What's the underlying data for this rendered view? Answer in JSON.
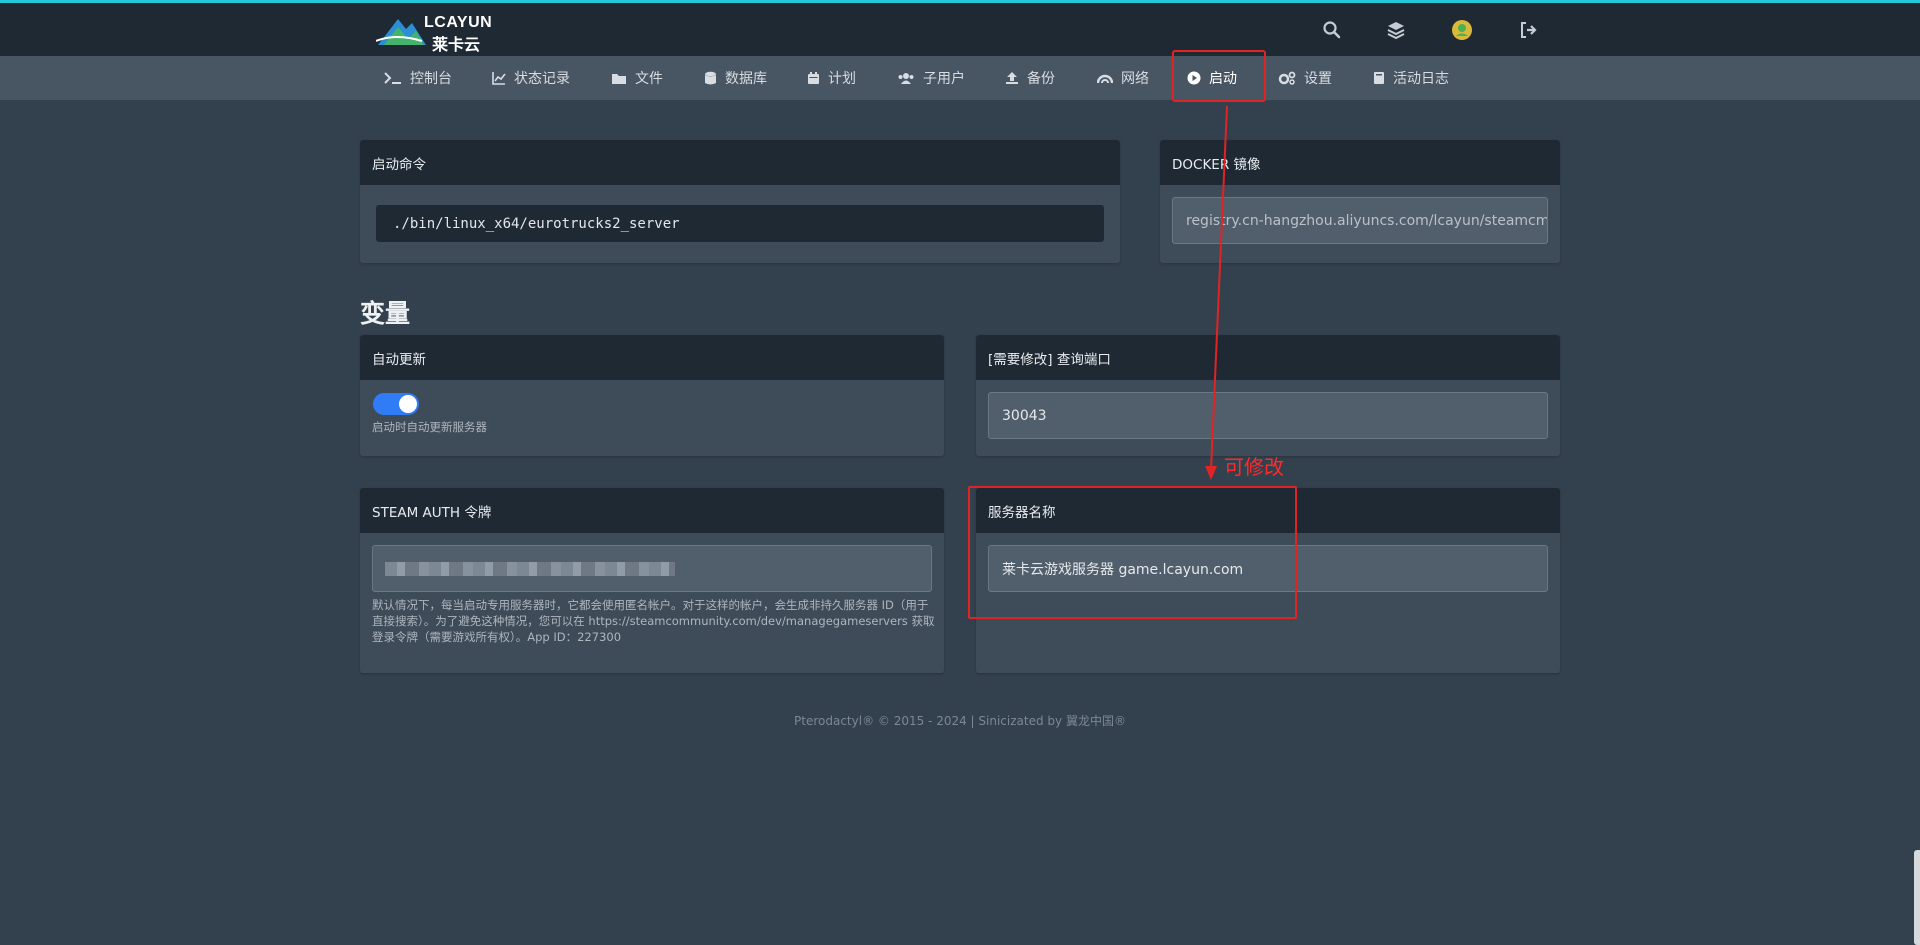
{
  "brand": {
    "logo_text_en": "LCAYUN",
    "logo_text_cn": "莱卡云"
  },
  "topbar": {
    "icons": [
      "search-icon",
      "layers-icon",
      "user-avatar-icon",
      "logout-icon"
    ]
  },
  "nav": {
    "items": [
      {
        "label": "控制台",
        "icon": "terminal-icon"
      },
      {
        "label": "状态记录",
        "icon": "chart-icon"
      },
      {
        "label": "文件",
        "icon": "folder-icon"
      },
      {
        "label": "数据库",
        "icon": "database-icon"
      },
      {
        "label": "计划",
        "icon": "calendar-icon"
      },
      {
        "label": "子用户",
        "icon": "users-icon"
      },
      {
        "label": "备份",
        "icon": "upload-icon"
      },
      {
        "label": "网络",
        "icon": "network-icon"
      },
      {
        "label": "启动",
        "icon": "play-icon",
        "active": true
      },
      {
        "label": "设置",
        "icon": "cogs-icon"
      },
      {
        "label": "活动日志",
        "icon": "book-icon"
      }
    ]
  },
  "startup": {
    "command_title": "启动命令",
    "command": "./bin/linux_x64/eurotrucks2_server",
    "docker_title": "DOCKER 镜像",
    "docker_image": "registry.cn-hangzhou.aliyuncs.com/lcayun/steamcmd"
  },
  "variables": {
    "title": "变量",
    "auto_update": {
      "title": "自动更新",
      "enabled": true,
      "description": "启动时自动更新服务器"
    },
    "query_port": {
      "title": "[需要修改] 查询端口",
      "value": "30043"
    },
    "steam_auth": {
      "title": "STEAM AUTH 令牌",
      "description": "默认情况下，每当启动专用服务器时，它都会使用匿名帐户。对于这样的帐户，会生成非持久服务器 ID（用于直接搜索）。为了避免这种情况，您可以在 https://steamcommunity.com/dev/managegameservers 获取登录令牌（需要游戏所有权）。App ID：227300"
    },
    "server_name": {
      "title": "服务器名称",
      "value": "莱卡云游戏服务器 game.lcayun.com"
    }
  },
  "annotation": {
    "label": "可修改",
    "color": "#e02424"
  },
  "footer": {
    "text": "Pterodactyl® © 2015 - 2024 | Sinicizated by 翼龙中国®"
  },
  "colors": {
    "accent": "#2f7cf6",
    "topline": "#26c6da",
    "background": "#33404d"
  }
}
